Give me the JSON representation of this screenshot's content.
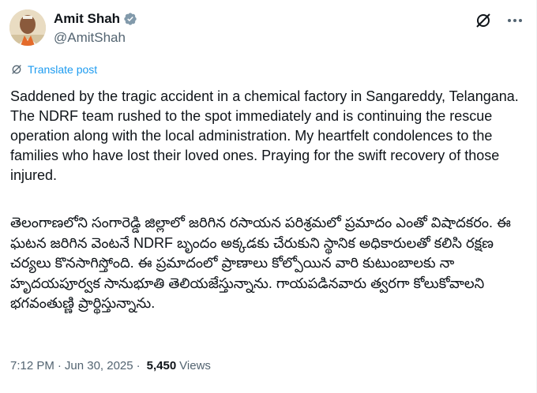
{
  "author": {
    "name": "Amit Shah",
    "handle": "@AmitShah",
    "verified": true
  },
  "translate_label": "Translate post",
  "body_english": "Saddened by the tragic accident in a chemical factory in Sangareddy, Telangana. The NDRF team rushed to the spot immediately and is continuing the rescue operation along with the local administration. My heartfelt condolences to the families who have lost their loved ones. Praying for the swift recovery of those injured.",
  "body_telugu": "తెలంగాణలోని సంగారెడ్డి జిల్లాలో జరిగిన రసాయన పరిశ్రమలో ప్రమాదం ఎంతో విషాదకరం. ఈ ఘటన జరిగిన వెంటనే NDRF బృందం అక్కడకు చేరుకుని స్థానిక అధికారులతో కలిసి రక్షణ చర్యలు కొనసాగిస్తోంది. ఈ ప్రమాదంలో ప్రాణాలు కోల్పోయిన వారి కుటుంబాలకు నా హృదయపూర్వక సానుభూతి తెలియజేస్తున్నాను. గాయపడినవారు త్వరగా కోలుకోవాలని భగవంతుణ్ణి ప్రార్థిస్తున్నాను.",
  "meta": {
    "time": "7:12 PM",
    "separator1": "·",
    "date": "Jun 30, 2025",
    "separator2": "·",
    "views_count": "5,450",
    "views_label": "Views"
  },
  "colors": {
    "accent": "#1d9bf0",
    "text": "#0f1419",
    "secondary": "#536471",
    "verified": "#829aab"
  },
  "icons": {
    "verified": "verified-badge-icon",
    "grok": "grok-icon",
    "more": "more-icon",
    "translate": "translate-icon"
  }
}
